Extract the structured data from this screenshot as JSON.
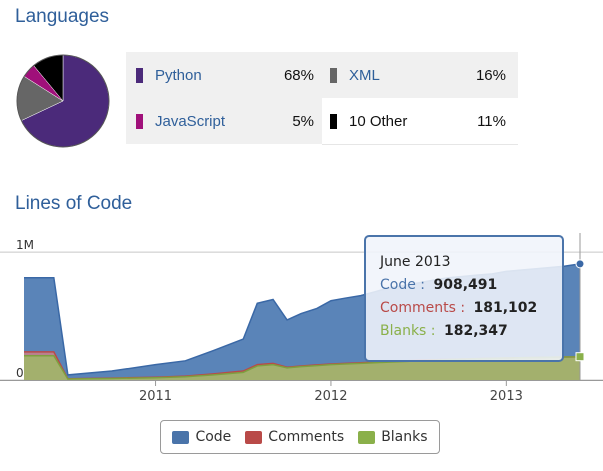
{
  "languages": {
    "title": "Languages",
    "items": [
      {
        "name": "Python",
        "percent": "68%",
        "value": 68,
        "color": "#4b2a7a",
        "link": true
      },
      {
        "name": "XML",
        "percent": "16%",
        "value": 16,
        "color": "#666666",
        "link": true
      },
      {
        "name": "JavaScript",
        "percent": "5%",
        "value": 5,
        "color": "#a0107a",
        "link": true
      },
      {
        "name": "10 Other",
        "percent": "11%",
        "value": 11,
        "color": "#000000",
        "link": false
      }
    ]
  },
  "loc": {
    "title": "Lines of Code",
    "tooltip": {
      "date": "June 2013",
      "code_label": "Code",
      "code_value": "908,491",
      "comments_label": "Comments",
      "comments_value": "181,102",
      "blanks_label": "Blanks",
      "blanks_value": "182,347"
    },
    "legend": [
      {
        "name": "Code",
        "color": "#4a74aa"
      },
      {
        "name": "Comments",
        "color": "#b94a48"
      },
      {
        "name": "Blanks",
        "color": "#8ab04a"
      }
    ]
  },
  "chart_data": [
    {
      "type": "pie",
      "labels": [
        "Python",
        "XML",
        "JavaScript",
        "10 Other"
      ],
      "values": [
        68,
        16,
        5,
        11
      ],
      "colors": [
        "#4b2a7a",
        "#666666",
        "#a0107a",
        "#000000"
      ]
    },
    {
      "type": "area",
      "title": "Lines of Code",
      "x": [
        2010.25,
        2010.33,
        2010.42,
        2010.5,
        2010.75,
        2011.0,
        2011.17,
        2011.33,
        2011.5,
        2011.58,
        2011.67,
        2011.75,
        2011.83,
        2011.92,
        2012.0,
        2012.08,
        2012.17,
        2012.25,
        2012.33,
        2012.42,
        2012.5,
        2012.58,
        2012.67,
        2012.75,
        2012.83,
        2012.92,
        2013.0,
        2013.08,
        2013.17,
        2013.25,
        2013.33,
        2013.42
      ],
      "series": [
        {
          "name": "Code",
          "values": [
            800000,
            800000,
            800000,
            40000,
            70000,
            120000,
            150000,
            230000,
            320000,
            600000,
            630000,
            470000,
            520000,
            560000,
            620000,
            640000,
            660000,
            690000,
            720000,
            740000,
            760000,
            780000,
            800000,
            810000,
            820000,
            830000,
            850000,
            860000,
            870000,
            880000,
            890000,
            908491
          ]
        },
        {
          "name": "Comments",
          "values": [
            220000,
            220000,
            220000,
            10000,
            15000,
            22000,
            30000,
            48000,
            70000,
            120000,
            130000,
            100000,
            110000,
            118000,
            125000,
            130000,
            135000,
            140000,
            145000,
            150000,
            155000,
            158000,
            161000,
            164000,
            167000,
            170000,
            172000,
            174000,
            176000,
            178000,
            180000,
            181102
          ]
        },
        {
          "name": "Blanks",
          "values": [
            190000,
            190000,
            190000,
            8000,
            12000,
            18000,
            25000,
            40000,
            60000,
            110000,
            120000,
            95000,
            105000,
            112000,
            120000,
            125000,
            130000,
            135000,
            140000,
            145000,
            150000,
            155000,
            160000,
            163000,
            166000,
            169000,
            172000,
            174000,
            176000,
            178000,
            180000,
            182347
          ]
        }
      ],
      "x_ticks": [
        "2011",
        "2012",
        "2013"
      ],
      "x_tick_values": [
        2011,
        2012,
        2013
      ],
      "y_ticks": [
        "0M",
        "1M"
      ],
      "y_tick_values": [
        0,
        1000000
      ],
      "xlim": [
        2010.25,
        2013.42
      ],
      "ylim": [
        0,
        1150000
      ],
      "stacked": true,
      "grid": true,
      "legend_position": "bottom"
    }
  ]
}
